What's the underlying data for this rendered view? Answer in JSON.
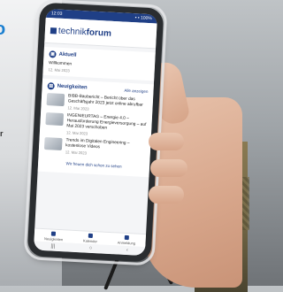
{
  "backdrop": {
    "logo_text": "o",
    "side_text": "r"
  },
  "screen": {
    "status_time": "12:03",
    "status_right": "▪ ▪ 100%",
    "app_name_plain": "technik",
    "app_name_bold": "forum",
    "current": {
      "heading": "Aktuell",
      "item_title": "Willkommen",
      "item_date": "12. Mai 2023"
    },
    "news": {
      "heading": "Neuigkeiten",
      "more_label": "Alle anzeigen",
      "items": [
        {
          "title": "BIBB-Baubericht – Bericht über das Geschäftsjahr 2023 jetzt online abrufbar",
          "date": "12. Mai 2023"
        },
        {
          "title": "INGENIEURTAG – Energie 4.0 – Herausforderung Energieversorgung – auf Mai 2023 verschoben",
          "date": "12. Mai 2023"
        },
        {
          "title": "Trends im Digitalen Engineering – kostenlose Videos",
          "date": "12. Mai 2023"
        }
      ]
    },
    "notice": "Wir freuen dich schon zu sehen",
    "tabs": [
      {
        "label": "Neuigkeiten"
      },
      {
        "label": "Kalender"
      },
      {
        "label": "Anmeldung"
      }
    ],
    "nav": [
      "|||",
      "○",
      "‹"
    ]
  }
}
